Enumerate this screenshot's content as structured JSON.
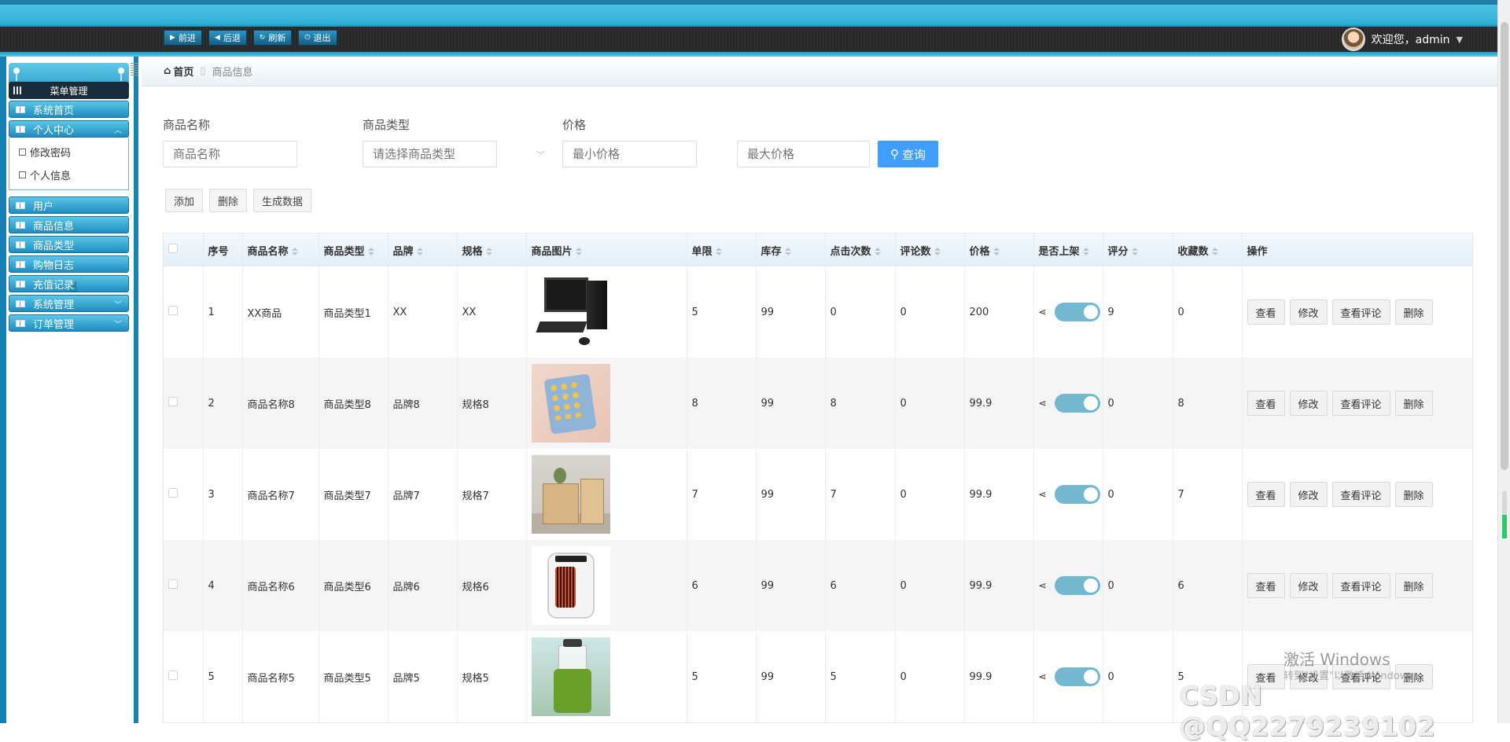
{
  "toolbar": {
    "buttons": [
      {
        "icon": "play-right-icon",
        "label": "前进"
      },
      {
        "icon": "triangle-left-icon",
        "label": "后退"
      },
      {
        "icon": "refresh-icon",
        "label": "刷新"
      },
      {
        "icon": "power-icon",
        "label": "退出"
      }
    ],
    "greeting": "欢迎您，admin"
  },
  "sidebar": {
    "title": "菜单管理",
    "items": [
      {
        "label": "系统首页",
        "expandable": false
      },
      {
        "label": "个人中心",
        "expandable": true,
        "expanded": true,
        "children": [
          "修改密码",
          "个人信息"
        ]
      },
      {
        "label": "用户",
        "expandable": false
      },
      {
        "label": "商品信息",
        "expandable": false,
        "active": true
      },
      {
        "label": "商品类型",
        "expandable": false
      },
      {
        "label": "购物日志",
        "expandable": false
      },
      {
        "label": "充值记录",
        "expandable": false
      },
      {
        "label": "系统管理",
        "expandable": true
      },
      {
        "label": "订单管理",
        "expandable": true
      }
    ]
  },
  "breadcrumb": {
    "home": "首页",
    "current": "商品信息"
  },
  "search": {
    "name_label": "商品名称",
    "name_placeholder": "商品名称",
    "type_label": "商品类型",
    "type_placeholder": "请选择商品类型",
    "price_label": "价格",
    "min_price_placeholder": "最小价格",
    "max_price_placeholder": "最大价格",
    "query_label": "查询"
  },
  "actions": {
    "add": "添加",
    "delete": "删除",
    "generate": "生成数据"
  },
  "table": {
    "headers": [
      "序号",
      "商品名称",
      "商品类型",
      "品牌",
      "规格",
      "商品图片",
      "单限",
      "库存",
      "点击次数",
      "评论数",
      "价格",
      "是否上架",
      "评分",
      "收藏数",
      "操作"
    ],
    "op_labels": {
      "view": "查看",
      "edit": "修改",
      "comments": "查看评论",
      "delete": "删除"
    },
    "rows": [
      {
        "no": "1",
        "name": "XX商品",
        "type": "商品类型1",
        "brand": "XX",
        "spec": "XX",
        "picture": "computer",
        "limit": "5",
        "stock": "99",
        "clicks": "0",
        "comments": "0",
        "price": "200",
        "on_shelf": true,
        "rating": "9",
        "favorites": "0"
      },
      {
        "no": "2",
        "name": "商品名称8",
        "type": "商品类型8",
        "brand": "品牌8",
        "spec": "规格8",
        "picture": "cookies",
        "limit": "8",
        "stock": "99",
        "clicks": "8",
        "comments": "0",
        "price": "99.9",
        "on_shelf": true,
        "rating": "0",
        "favorites": "8"
      },
      {
        "no": "3",
        "name": "商品名称7",
        "type": "商品类型7",
        "brand": "品牌7",
        "spec": "规格7",
        "picture": "cabinet",
        "limit": "7",
        "stock": "99",
        "clicks": "7",
        "comments": "0",
        "price": "99.9",
        "on_shelf": true,
        "rating": "0",
        "favorites": "7"
      },
      {
        "no": "4",
        "name": "商品名称6",
        "type": "商品类型6",
        "brand": "品牌6",
        "spec": "规格6",
        "picture": "heater",
        "limit": "6",
        "stock": "99",
        "clicks": "6",
        "comments": "0",
        "price": "99.9",
        "on_shelf": true,
        "rating": "0",
        "favorites": "6"
      },
      {
        "no": "5",
        "name": "商品名称5",
        "type": "商品类型5",
        "brand": "品牌5",
        "spec": "规格5",
        "picture": "bottle",
        "limit": "5",
        "stock": "99",
        "clicks": "5",
        "comments": "0",
        "price": "99.9",
        "on_shelf": true,
        "rating": "0",
        "favorites": "5"
      }
    ]
  },
  "watermarks": {
    "activate": "激活 Windows",
    "activate_sub": "转到\"设置\"以激活 Windows。",
    "csdn": "CSDN @QQ2279239102"
  },
  "colors": {
    "accent": "#409eff",
    "menu": "#1e8dc0",
    "switch_on": "#73b8d1"
  }
}
